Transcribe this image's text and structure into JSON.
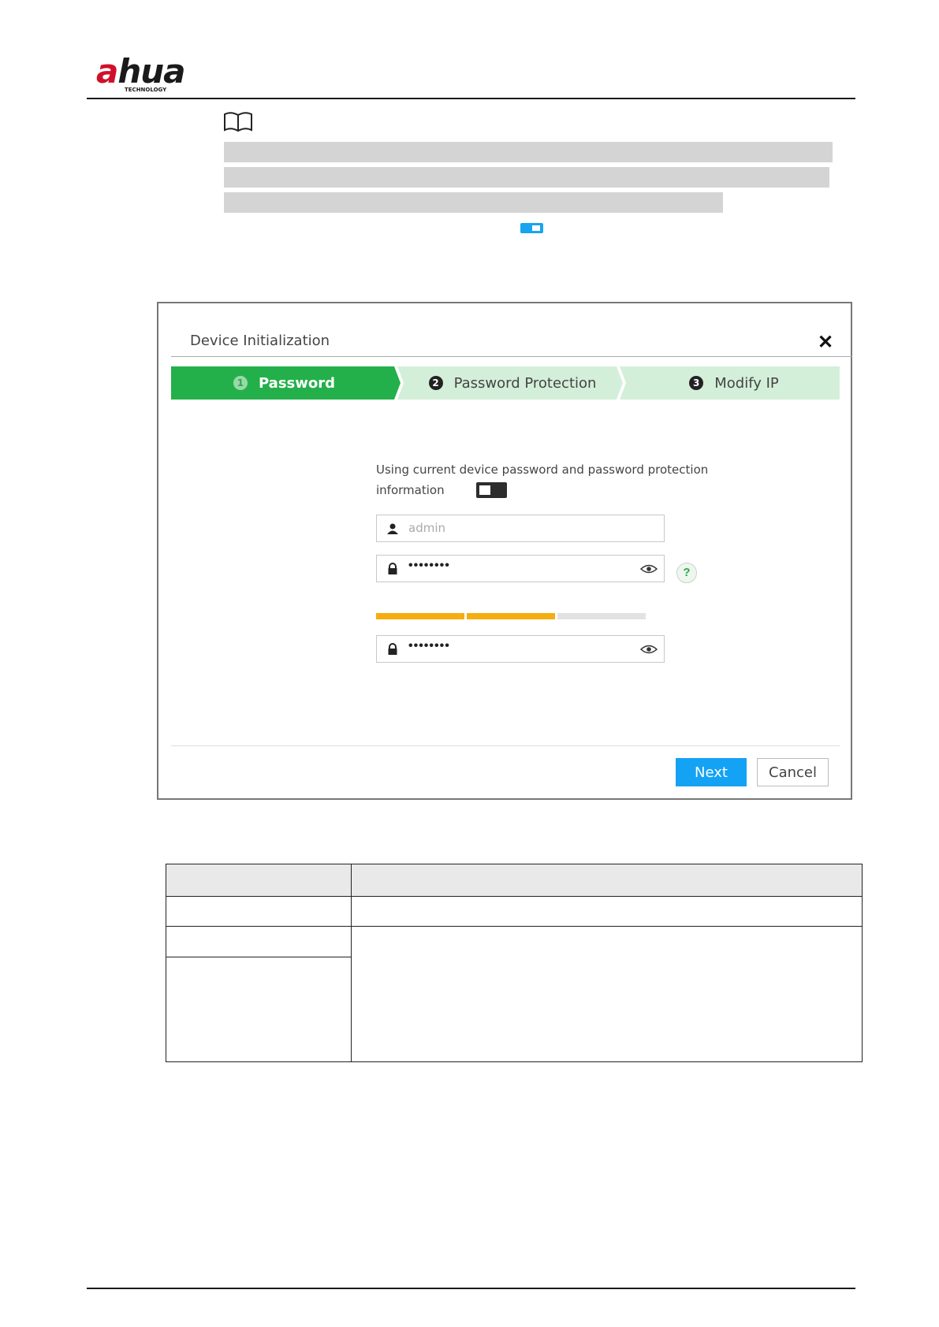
{
  "brand": {
    "logo_text_red": "a",
    "logo_text": "hua",
    "logo_sub": "TECHNOLOGY",
    "logo_color": "#d0102b"
  },
  "dialog": {
    "title": "Device Initialization",
    "close_icon": "close-icon",
    "steps": [
      {
        "num": "1",
        "label": "Password",
        "state": "active"
      },
      {
        "num": "2",
        "label": "Password Protection",
        "state": "pending"
      },
      {
        "num": "3",
        "label": "Modify IP",
        "state": "pending"
      }
    ],
    "toggle_label": "Using current device password and password protection information",
    "toggle_state": "off",
    "username": {
      "value": "admin",
      "icon": "user-icon"
    },
    "password": {
      "value": "••••••••",
      "icon": "lock-icon"
    },
    "password_strength": {
      "filled_segments": 2,
      "total_segments": 3,
      "color": "#f5ad0f"
    },
    "confirm_password": {
      "value": "••••••••",
      "icon": "lock-icon"
    },
    "help_label": "?",
    "next_label": "Next",
    "cancel_label": "Cancel",
    "colors": {
      "active_step": "#23b04a",
      "pending_step": "#d4efd9",
      "primary": "#14a2f4"
    }
  }
}
